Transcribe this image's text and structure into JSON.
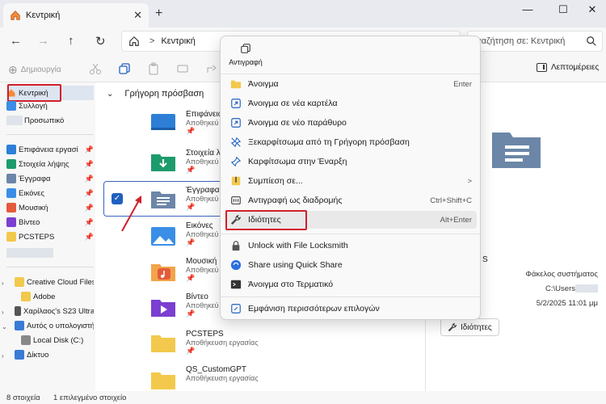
{
  "window": {
    "tab_title": "Κεντρική",
    "tab_close": "✕",
    "new_tab": "+",
    "minimize": "—",
    "maximize": "☐",
    "close": "✕"
  },
  "nav": {
    "back": "←",
    "forward": "→",
    "up": "↑",
    "refresh": "↻",
    "breadcrumb_sep": ">",
    "location": "Κεντρική",
    "search_placeholder": "Αναζήτηση σε: Κεντρική"
  },
  "toolbar": {
    "new_label": "Δημιουργία",
    "new_icon": "⊕",
    "details_label": "Λεπτομέρειες"
  },
  "sidebar": {
    "home": "Κεντρική",
    "gallery": "Συλλογή",
    "personal": "Προσωπικό",
    "pin": "📌",
    "quick": [
      {
        "label": "Επιφάνεια εργασί",
        "color": "#2d7fd6"
      },
      {
        "label": "Στοιχεία λήψης",
        "color": "#1e9b6d"
      },
      {
        "label": "Έγγραφα",
        "color": "#6c86a8"
      },
      {
        "label": "Εικόνες",
        "color": "#3b8ee6"
      },
      {
        "label": "Μουσική",
        "color": "#e35b3c"
      },
      {
        "label": "Βίντεο",
        "color": "#7b3fd1"
      },
      {
        "label": "PCSTEPS",
        "color": "#f2c94c"
      }
    ],
    "drives": [
      {
        "label": "Creative Cloud Files F",
        "color": "#f2c94c"
      },
      {
        "label": "Adobe",
        "color": "#f2c94c"
      },
      {
        "label": "Χαρίλαος's S23 Ultra",
        "color": "#555555"
      },
      {
        "label": "Αυτός ο υπολογιστή",
        "color": "#3a7bd5"
      },
      {
        "label": "Local Disk (C:)",
        "color": "#888888"
      },
      {
        "label": "Δίκτυο",
        "color": "#3a7bd5"
      }
    ]
  },
  "main": {
    "section_title": "Γρήγορη πρόσβαση",
    "items": [
      {
        "name": "Επιφάνεια",
        "sub": "Αποθηκεύ"
      },
      {
        "name": "Στοιχεία λ",
        "sub": "Αποθηκεύ"
      },
      {
        "name": "Έγγραφα",
        "sub": "Αποθηκεύ"
      },
      {
        "name": "Εικόνες",
        "sub": "Αποθηκεύ"
      },
      {
        "name": "Μουσική",
        "sub": "Αποθηκεύ"
      },
      {
        "name": "Βίντεο",
        "sub": "Αποθηκεύ"
      },
      {
        "name": "PCSTEPS",
        "sub": "Αποθήκευση εργασίας"
      },
      {
        "name": "QS_CustomGPT",
        "sub": "Αποθήκευση εργασίας"
      }
    ],
    "pin": "📌",
    "checkmark": "✓"
  },
  "details": {
    "partial_title": "S",
    "type": "Φάκελος συστήματος",
    "path": "C:\\Users",
    "date": "5/2/2025 11:01 μμ",
    "properties_btn": "Ιδιότητες"
  },
  "status": {
    "count": "8 στοιχεία",
    "selected": "1 επιλεγμένο στοιχείο"
  },
  "context_menu": {
    "copy": "Αντιγραφή",
    "items": [
      {
        "label": "Άνοιγμα",
        "shortcut": "Enter",
        "icon": "folder-icon"
      },
      {
        "label": "Άνοιγμα σε νέα καρτέλα",
        "shortcut": "",
        "icon": "new-tab-icon"
      },
      {
        "label": "Άνοιγμα σε νέο παράθυρο",
        "shortcut": "",
        "icon": "new-window-icon"
      },
      {
        "label": "Ξεκαρφίτσωμα από τη Γρήγορη πρόσβαση",
        "shortcut": "",
        "icon": "unpin-icon"
      },
      {
        "label": "Καρφίτσωμα στην Έναρξη",
        "shortcut": "",
        "icon": "pin-icon"
      },
      {
        "label": "Συμπίεση σε...",
        "shortcut": ">",
        "icon": "zip-icon"
      },
      {
        "label": "Αντιγραφή ως διαδρομής",
        "shortcut": "Ctrl+Shift+C",
        "icon": "copy-path-icon"
      },
      {
        "label": "Ιδιότητες",
        "shortcut": "Alt+Enter",
        "icon": "wrench-icon"
      },
      {
        "label": "Unlock with File Locksmith",
        "shortcut": "",
        "icon": "lock-icon"
      },
      {
        "label": "Share using Quick Share",
        "shortcut": "",
        "icon": "quick-share-icon"
      },
      {
        "label": "Άνοιγμα στο Τερματικό",
        "shortcut": "",
        "icon": "terminal-icon"
      },
      {
        "label": "Εμφάνιση περισσότερων επιλογών",
        "shortcut": "",
        "icon": "more-options-icon"
      }
    ]
  },
  "colors": {
    "accent": "#1f5fbf",
    "highlight_box": "#d21f2b"
  }
}
